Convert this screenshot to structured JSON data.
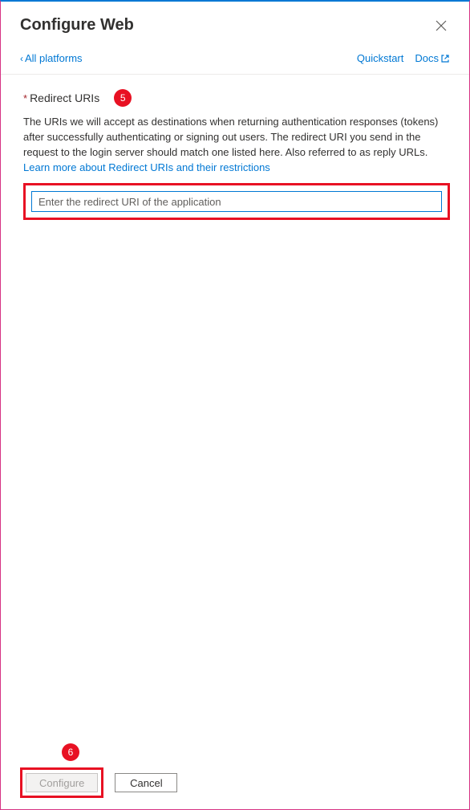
{
  "header": {
    "title": "Configure Web"
  },
  "topbar": {
    "back_label": "All platforms",
    "quickstart_label": "Quickstart",
    "docs_label": "Docs"
  },
  "section": {
    "heading": "Redirect URIs",
    "badge": "5",
    "desc_part1": "The URIs we will accept as destinations when returning authentication responses (tokens) after successfully authenticating or signing out users. The redirect URI you send in the request to the login server should match one listed here. Also referred to as reply URLs. ",
    "desc_link": "Learn more about Redirect URIs and their restrictions",
    "input_placeholder": "Enter the redirect URI of the application"
  },
  "footer": {
    "badge": "6",
    "configure_label": "Configure",
    "cancel_label": "Cancel"
  }
}
